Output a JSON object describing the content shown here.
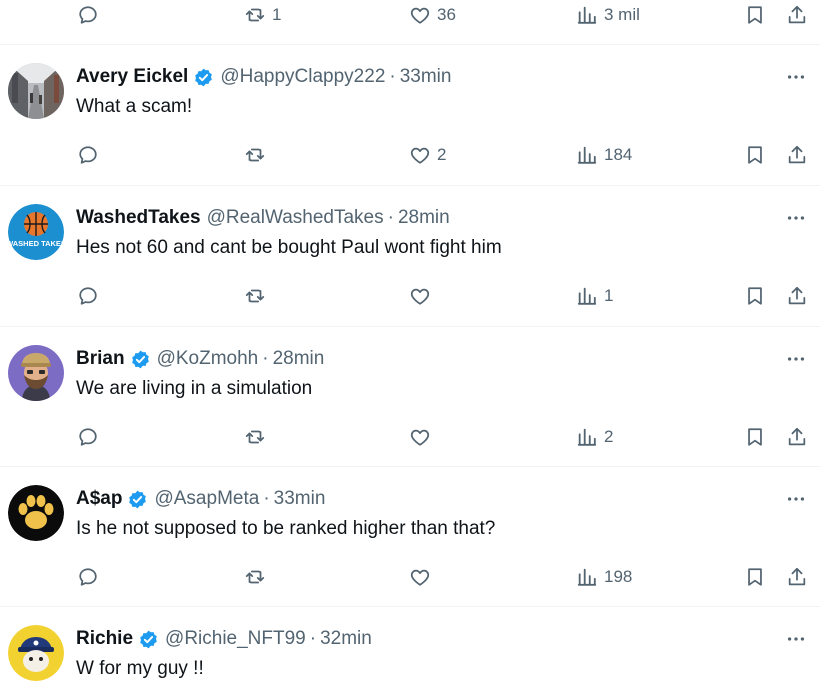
{
  "top_actions": {
    "replies": "",
    "reposts": "1",
    "likes": "36",
    "views": "3 mil"
  },
  "posts": [
    {
      "name": "Avery Eickel",
      "verified": true,
      "handle": "@HappyClappy222",
      "time": "33min",
      "text": "What a scam!",
      "replies": "",
      "reposts": "",
      "likes": "2",
      "views": "184",
      "avatar_icon": "street-photo"
    },
    {
      "name": "WashedTakes",
      "verified": false,
      "handle": "@RealWashedTakes",
      "time": "28min",
      "text": "Hes not 60 and cant be bought Paul wont fight him",
      "replies": "",
      "reposts": "",
      "likes": "",
      "views": "1",
      "avatar_icon": "basketball-logo",
      "avatar_text": "WASHED TAKES"
    },
    {
      "name": "Brian",
      "verified": true,
      "handle": "@KoZmohh",
      "time": "28min",
      "text": "We are living in a simulation",
      "replies": "",
      "reposts": "",
      "likes": "",
      "views": "2",
      "avatar_icon": "bearded-man-cartoon"
    },
    {
      "name": "A$ap",
      "verified": true,
      "handle": "@AsapMeta",
      "time": "33min",
      "text": "Is he not supposed to be ranked higher than that?",
      "replies": "",
      "reposts": "",
      "likes": "",
      "views": "198",
      "avatar_icon": "paw-print"
    },
    {
      "name": "Richie",
      "verified": true,
      "handle": "@Richie_NFT99",
      "time": "32min",
      "text": "W for my guy !!",
      "avatar_icon": "pirate-cartoon"
    }
  ],
  "colors": {
    "text": "#0f1419",
    "muted": "#536471",
    "verified": "#1d9bf0",
    "divider": "#eff3f4"
  }
}
